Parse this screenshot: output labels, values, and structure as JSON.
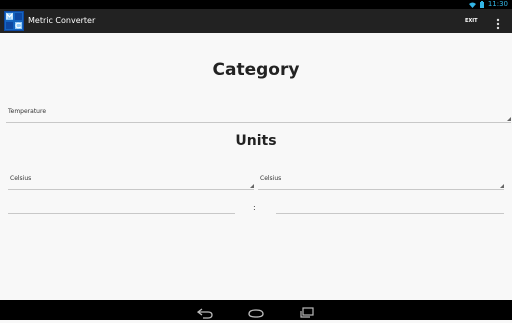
{
  "status_bar": {
    "time": "11:30"
  },
  "action_bar": {
    "app_icon_text": "MC",
    "title": "Metric Converter",
    "exit_label": "EXIT"
  },
  "category": {
    "heading": "Category",
    "selected": "Temperature"
  },
  "units": {
    "heading": "Units",
    "from_unit": "Celsius",
    "to_unit": "Celsius",
    "separator": ":",
    "from_value": "",
    "to_value": ""
  },
  "colors": {
    "background": "#f8f8f8",
    "action_bar": "#222222",
    "status_accent": "#33b5e5",
    "app_icon": "#1565c0"
  }
}
